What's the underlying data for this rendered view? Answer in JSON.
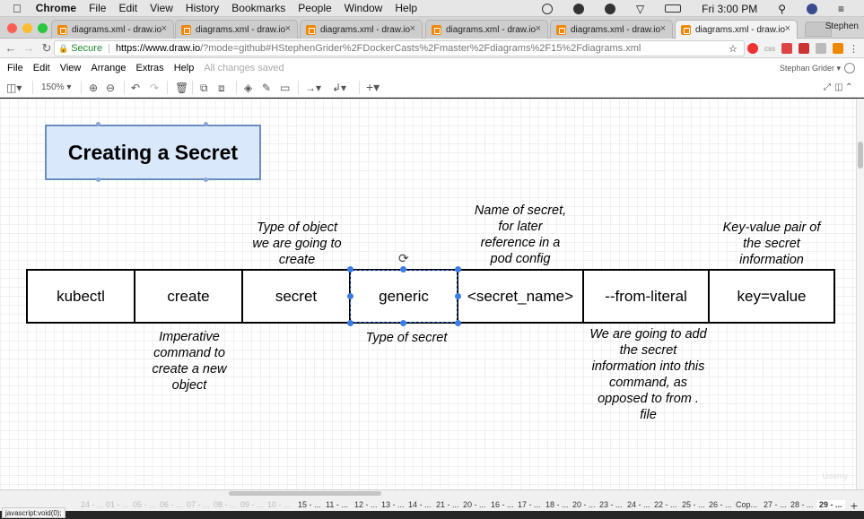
{
  "mac_menubar": {
    "apple": "",
    "app": "Chrome",
    "items": [
      "File",
      "Edit",
      "View",
      "History",
      "Bookmarks",
      "People",
      "Window",
      "Help"
    ],
    "clock": "Fri 3:00 PM"
  },
  "browser": {
    "tabs": [
      {
        "label": "diagrams.xml - draw.io"
      },
      {
        "label": "diagrams.xml - draw.io"
      },
      {
        "label": "diagrams.xml - draw.io"
      },
      {
        "label": "diagrams.xml - draw.io"
      },
      {
        "label": "diagrams.xml - draw.io"
      },
      {
        "label": "diagrams.xml - draw.io"
      }
    ],
    "profile": "Stephen",
    "secure_label": "Secure",
    "url_domain": "https://www.draw.io",
    "url_path": "/?mode=github#HStephenGrider%2FDockerCasts%2Fmaster%2Fdiagrams%2F15%2Fdiagrams.xml"
  },
  "app_menu": {
    "items": [
      "File",
      "Edit",
      "View",
      "Arrange",
      "Extras",
      "Help"
    ],
    "saved_status": "All changes saved",
    "user": "Stephan Grider"
  },
  "toolbar": {
    "zoom": "150%"
  },
  "diagram": {
    "title": "Creating a Secret",
    "command_parts": [
      "kubectl",
      "create",
      "secret",
      "generic",
      "<secret_name>",
      "--from-literal",
      "key=value"
    ],
    "notes": {
      "type_of_object": [
        "Type of object",
        "we are going to",
        "create"
      ],
      "name_of_secret": [
        "Name of secret,",
        "for later",
        "reference in a",
        "pod config"
      ],
      "key_value": [
        "Key-value pair of",
        "the secret",
        "information"
      ],
      "imperative": [
        "Imperative",
        "command to",
        "create a new",
        "object"
      ],
      "type_of_secret": [
        "Type of secret"
      ],
      "from_literal": [
        "We are going to add",
        "the secret",
        "information into this",
        "command, as",
        "opposed to from .",
        "file"
      ]
    }
  },
  "pages": {
    "dim_tabs": [
      "24 - ...",
      "01 - ...",
      "05 - ...",
      "06 - ...",
      "07 - ...",
      "08 - ...",
      "09 - ...",
      "10 - ..."
    ],
    "tabs": [
      "15 - ...",
      "11 - ...",
      "12 - ...",
      "13 - ...",
      "14 - ...",
      "21 - ...",
      "20 - ...",
      "16 - ...",
      "17 - ...",
      "18 - ...",
      "20 - ...",
      "23 - ...",
      "24 - ...",
      "22 - ...",
      "25 - ...",
      "26 - ...",
      "Cop...",
      "27 - ...",
      "28 - ..."
    ],
    "active": "29 - ..."
  },
  "statusbar": "javascript:void(0);",
  "watermark": "Udemy",
  "colors": {
    "title_fill": "#dae8fc",
    "title_stroke": "#6c8ebf",
    "selection": "#3b7ce6",
    "drawio_orange": "#f08705"
  }
}
